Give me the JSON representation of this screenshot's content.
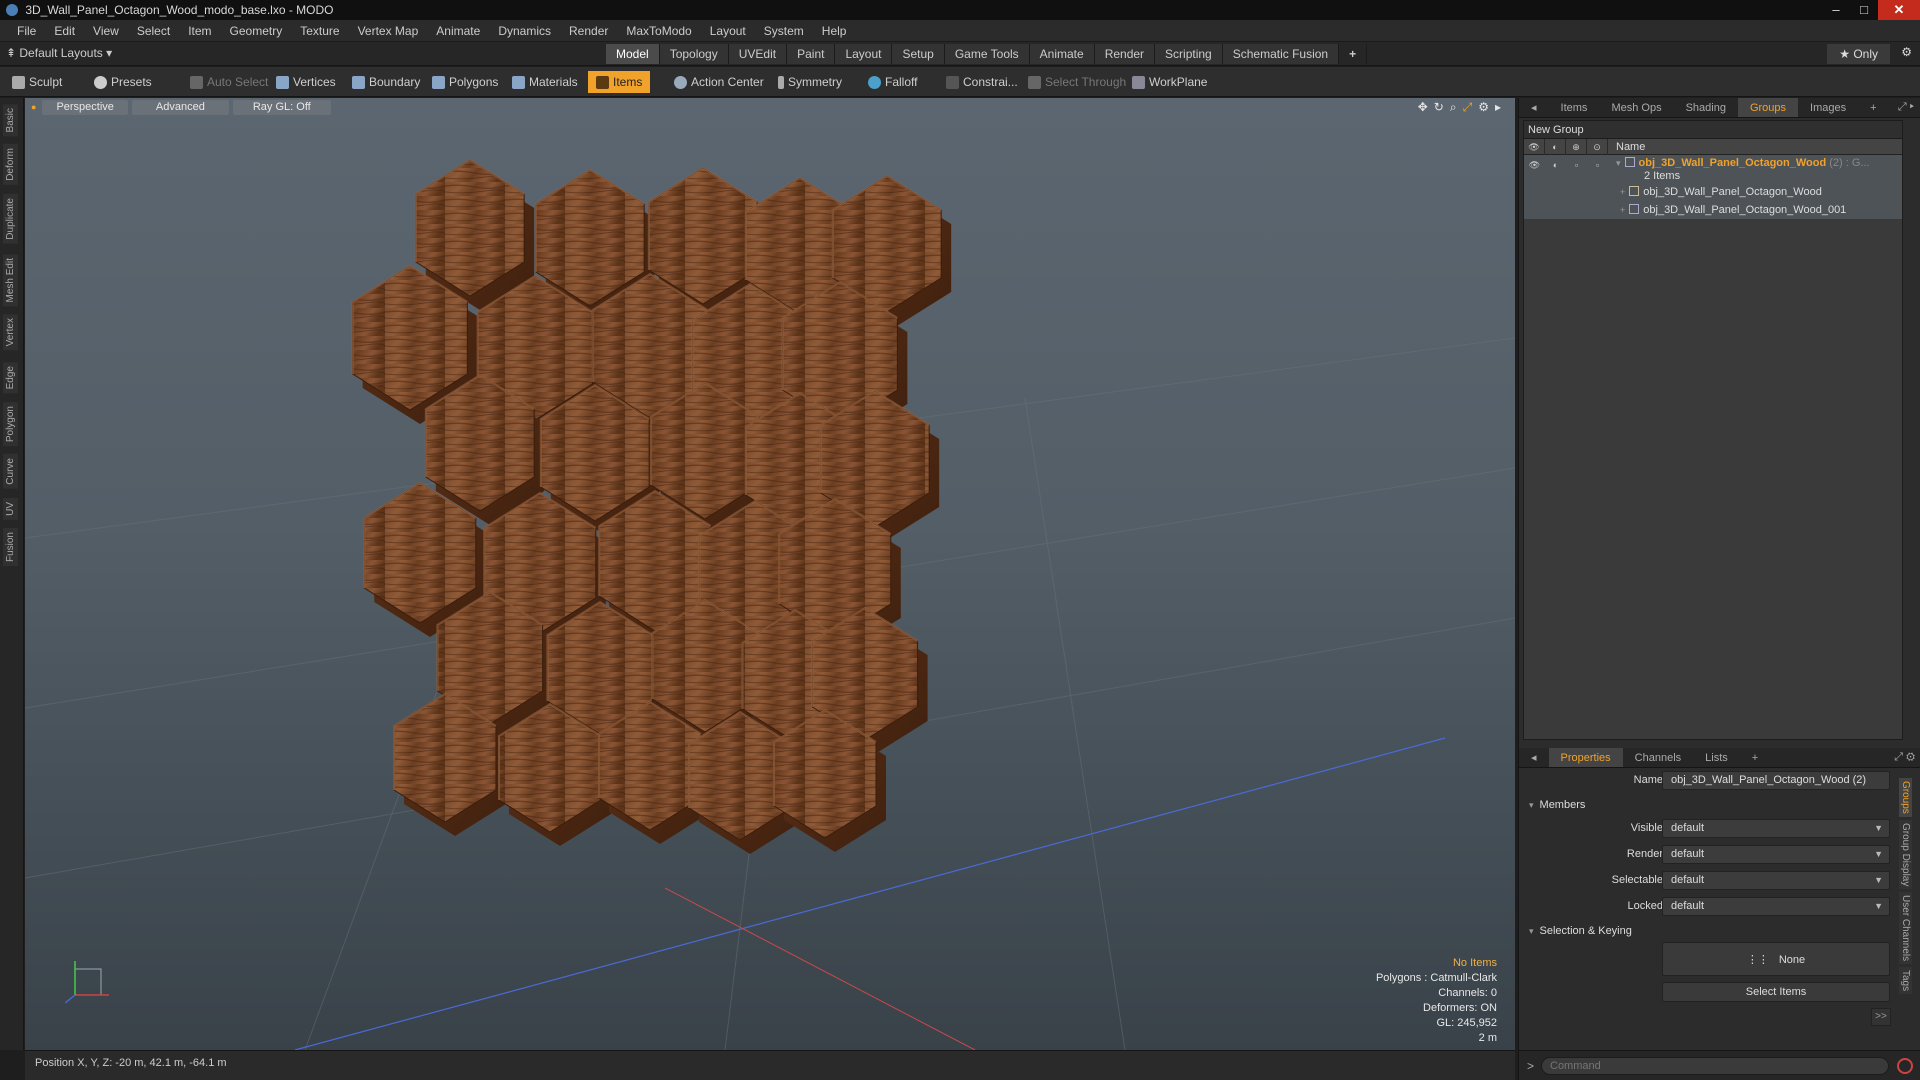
{
  "window": {
    "title": "3D_Wall_Panel_Octagon_Wood_modo_base.lxo - MODO"
  },
  "menu": [
    "File",
    "Edit",
    "View",
    "Select",
    "Item",
    "Geometry",
    "Texture",
    "Vertex Map",
    "Animate",
    "Dynamics",
    "Render",
    "MaxToModo",
    "Layout",
    "System",
    "Help"
  ],
  "layout": {
    "preset": "Default Layouts ▾",
    "tabs": [
      "Model",
      "Topology",
      "UVEdit",
      "Paint",
      "Layout",
      "Setup",
      "Game Tools",
      "Animate",
      "Render",
      "Scripting",
      "Schematic Fusion"
    ],
    "active_tab": "Model",
    "only_label": "★ Only"
  },
  "toolbar": {
    "sculpt": "Sculpt",
    "presets": "Presets",
    "auto_select": "Auto Select",
    "vertices": "Vertices",
    "boundary": "Boundary",
    "polygons": "Polygons",
    "materials": "Materials",
    "items": "Items",
    "action_center": "Action Center",
    "symmetry": "Symmetry",
    "falloff": "Falloff",
    "constraints": "Constrai...",
    "select_through": "Select Through",
    "workplane": "WorkPlane"
  },
  "left_tabs": [
    "Basic",
    "Deform",
    "Duplicate",
    "Mesh Edit",
    "Vertex",
    "Edge",
    "Polygon",
    "Curve",
    "UV",
    "Fusion"
  ],
  "viewport": {
    "view": "Perspective",
    "advanced": "Advanced",
    "raygl": "Ray GL: Off",
    "info": {
      "selection": "No Items",
      "polygons": "Polygons : Catmull-Clark",
      "channels": "Channels: 0",
      "deformers": "Deformers: ON",
      "gl": "GL: 245,952",
      "scale": "2 m"
    }
  },
  "status": {
    "position": "Position X, Y, Z:  -20 m, 42.1 m, -64.1 m"
  },
  "panel_tabs": [
    "Items",
    "Mesh Ops",
    "Shading",
    "Groups",
    "Images"
  ],
  "panel_active": "Groups",
  "groups": {
    "new_group": "New Group",
    "name_col": "Name",
    "group_name": "obj_3D_Wall_Panel_Octagon_Wood",
    "group_count": "(2) : G...",
    "items_count": "2 Items",
    "children": [
      "obj_3D_Wall_Panel_Octagon_Wood",
      "obj_3D_Wall_Panel_Octagon_Wood_001"
    ]
  },
  "props_tabs": [
    "Properties",
    "Channels",
    "Lists"
  ],
  "props": {
    "name_label": "Name",
    "name_value": "obj_3D_Wall_Panel_Octagon_Wood (2)",
    "members": "Members",
    "visible_label": "Visible",
    "visible_value": "default",
    "render_label": "Render",
    "render_value": "default",
    "selectable_label": "Selectable",
    "selectable_value": "default",
    "locked_label": "Locked",
    "locked_value": "default",
    "selection_keying": "Selection & Keying",
    "none_label": "None",
    "select_items": "Select Items",
    "more": ">>"
  },
  "side_tabs": [
    "Groups",
    "Group Display",
    "User Channels",
    "Tags"
  ],
  "command": {
    "placeholder": "Command"
  },
  "colors": {
    "accent": "#f0a22a",
    "wood_light": "#8a5535",
    "wood_dark": "#4a2612"
  }
}
